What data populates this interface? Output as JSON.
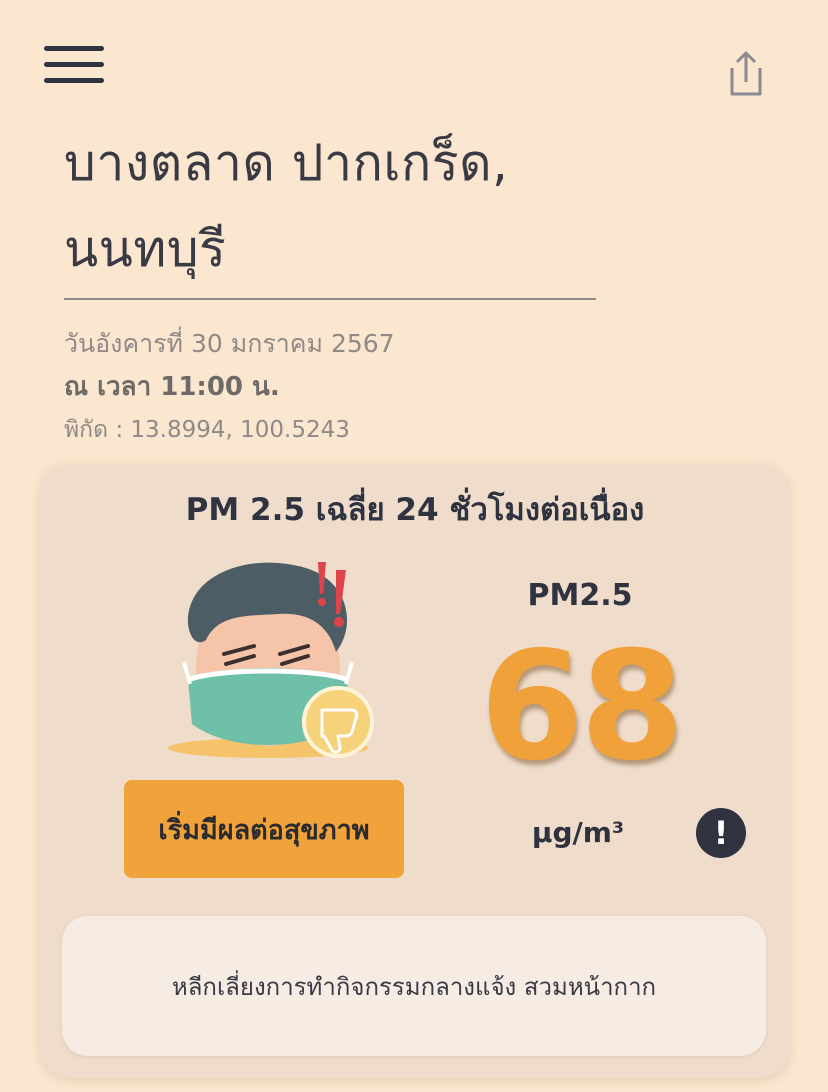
{
  "header": {
    "menu_icon": "hamburger-menu-icon",
    "share_icon": "share-icon"
  },
  "location": {
    "line1": "บางตลาด ปากเกร็ด,",
    "line2": "นนทบุรี"
  },
  "meta": {
    "date": "วันอังคารที่ 30 มกราคม 2567",
    "time": "ณ เวลา 11:00 น.",
    "coordinates": "พิกัด : 13.8994, 100.5243"
  },
  "card": {
    "title": "PM 2.5 เฉลี่ย 24 ชั่วโมงต่อเนื่อง",
    "status_label": "เริ่มมีผลต่อสุขภาพ",
    "metric_name": "PM2.5",
    "metric_value": "68",
    "unit": "µg/m³",
    "info_symbol": "!",
    "advice": "หลีกเลี่ยงการทำกิจกรรมกลางแจ้ง สวมหน้ากาก",
    "illustration": "masked-face-thumbs-down",
    "colors": {
      "accent": "#f0a13a",
      "card_bg": "#efdccb",
      "page_bg": "#fbe6cf"
    }
  }
}
